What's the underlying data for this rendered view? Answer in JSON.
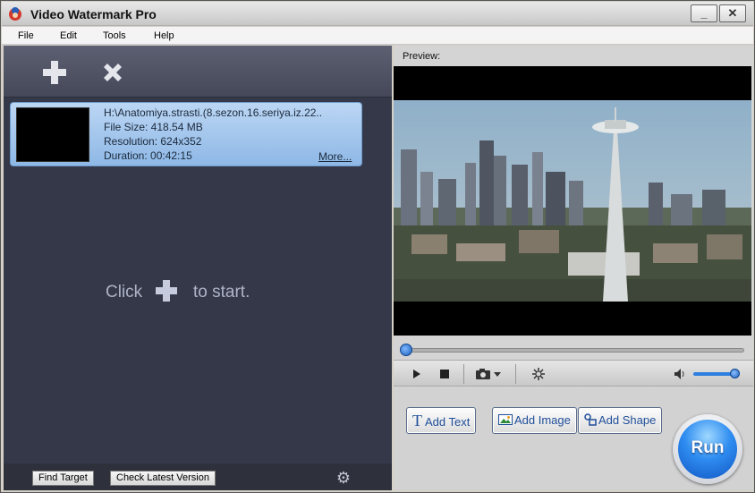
{
  "window": {
    "title": "Video Watermark Pro",
    "minimize": "_",
    "maximize": "□",
    "close": "✕"
  },
  "menu": [
    "File",
    "Edit",
    "Tools",
    "Help"
  ],
  "toolbar": {
    "add_icon": "plus-icon",
    "remove_icon": "x-icon"
  },
  "file_list": [
    {
      "path": "H:\\Anatomiya.strasti.(8.sezon.16.seriya.iz.22..",
      "size": "File Size: 418.54 MB",
      "resolution": "Resolution: 624x352",
      "duration": "Duration: 00:42:15",
      "more": "More..."
    }
  ],
  "start_hint": {
    "before": "Click",
    "after": "to start."
  },
  "footer": {
    "find_target": "Find Target",
    "check_version": "Check Latest Version"
  },
  "preview": {
    "label": "Preview:",
    "seek_fraction": 0.0,
    "volume_fraction": 0.95
  },
  "actions": {
    "add_text": "Add Text",
    "add_image": "Add Image",
    "add_shape": "Add Shape",
    "run": "Run"
  },
  "colors": {
    "accent_blue": "#1f4e9a",
    "panel_dark": "#353848",
    "card_blue": "#a4c6ee"
  }
}
